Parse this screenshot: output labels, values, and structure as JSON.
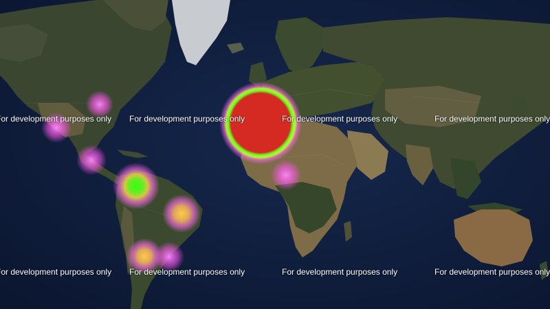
{
  "map": {
    "watermark_text": "For development purposes only",
    "base_imagery": "satellite",
    "ocean_color": "#0e1c3a",
    "land_color": "#3f4a33",
    "desert_color": "#8a7550",
    "ice_color": "#c9ccd0"
  },
  "heatmap": {
    "gradient": [
      "#ff66ff",
      "#ffcc55",
      "#66ff33",
      "#dd2222"
    ],
    "points": [
      {
        "region": "Iberia / Western Mediterranean",
        "intensity": 1.0
      },
      {
        "region": "Colombia / Venezuela",
        "intensity": 0.7
      },
      {
        "region": "Brazil",
        "intensity": 0.45
      },
      {
        "region": "Chile",
        "intensity": 0.45
      },
      {
        "region": "Argentina / Uruguay",
        "intensity": 0.3
      },
      {
        "region": "Mexico / Central America",
        "intensity": 0.25
      },
      {
        "region": "West Africa",
        "intensity": 0.25
      },
      {
        "region": "USA West Coast",
        "intensity": 0.2
      },
      {
        "region": "USA Central",
        "intensity": 0.2
      }
    ]
  }
}
